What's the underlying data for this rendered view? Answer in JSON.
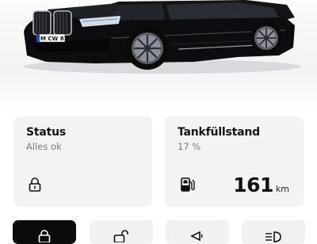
{
  "vehicle": {
    "license_plate": "M CW 8153"
  },
  "status_card": {
    "title": "Status",
    "subtitle": "Alles ok",
    "icon": "lock-icon"
  },
  "fuel_card": {
    "title": "Tankfüllstand",
    "subtitle": "17 %",
    "icon": "fuel-pump-icon",
    "range_value": "161",
    "range_unit": "km"
  },
  "action_tiles": [
    {
      "icon": "lock-icon",
      "active": true
    },
    {
      "icon": "unlock-icon",
      "active": false
    },
    {
      "icon": "horn-icon",
      "active": false
    },
    {
      "icon": "headlight-icon",
      "active": false
    }
  ],
  "colors": {
    "car_body": "#0d0d0f",
    "card_background": "#f3f3f3",
    "active_tile": "#0b0b0b"
  }
}
